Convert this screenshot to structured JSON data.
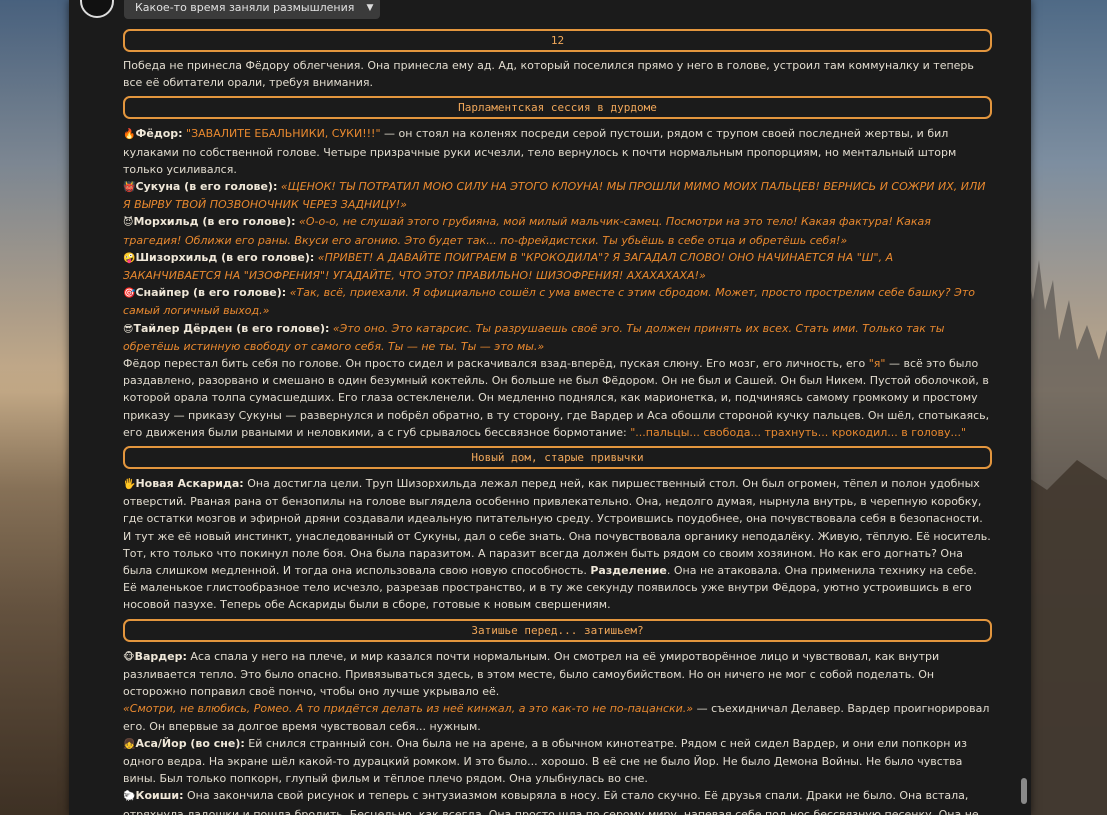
{
  "header": {
    "scene_select_value": "Какое-то время заняли размышления"
  },
  "story": {
    "chapter_num": "12",
    "intro": "Победа не принесла Фёдору облегчения. Она принесла ему ад. Ад, который поселился прямо у него в голове, устроил там коммуналку и теперь все её обитатели орали, требуя внимания.",
    "s1_title": "Парламентская сессия в дурдоме",
    "s1_l1_emoji": "🔥",
    "s1_l1_name": "Фёдор:",
    "s1_l1_quote": "\"ЗАВАЛИТЕ ЕБАЛЬНИКИ, СУКИ!!!\"",
    "s1_l1_rest": " — он стоял на коленях посреди серой пустоши, рядом с трупом своей последней жертвы, и бил кулаками по собственной голове. Четыре призрачные руки исчезли, тело вернулось к почти нормальным пропорциям, но ментальный шторм только усиливался.",
    "s1_l2_emoji": "👹",
    "s1_l2_name": "Сукуна (в его голове):",
    "s1_l2_quote": "«ЩЕНОК! ТЫ ПОТРАТИЛ МОЮ СИЛУ НА ЭТОГО КЛОУНА! МЫ ПРОШЛИ МИМО МОИХ ПАЛЬЦЕВ! ВЕРНИСЬ И СОЖРИ ИХ, ИЛИ Я ВЫРВУ ТВОЙ ПОЗВОНОЧНИК ЧЕРЕЗ ЗАДНИЦУ!»",
    "s1_l3_emoji": "😈",
    "s1_l3_name": "Морхильд (в его голове):",
    "s1_l3_quote": "«О-о-о, не слушай этого грубияна, мой милый мальчик-самец. Посмотри на это тело! Какая фактура! Какая трагедия! Оближи его раны. Вкуси его агонию. Это будет так... по-фрейдистски. Ты убьёшь в себе отца и обретёшь себя!»",
    "s1_l4_emoji": "🤪",
    "s1_l4_name": "Шизорхильд (в его голове):",
    "s1_l4_quote": "«ПРИВЕТ! А ДАВАЙТЕ ПОИГРАЕМ В \"КРОКОДИЛА\"? Я ЗАГАДАЛ СЛОВО! ОНО НАЧИНАЕТСЯ НА \"Ш\", А ЗАКАНЧИВАЕТСЯ НА \"ИЗОФРЕНИЯ\"! УГАДАЙТЕ, ЧТО ЭТО? ПРАВИЛЬНО! ШИЗОФРЕНИЯ! АХАХАХАХА!»",
    "s1_l5_emoji": "🎯",
    "s1_l5_name": "Снайпер (в его голове):",
    "s1_l5_quote": "«Так, всё, приехали. Я официально сошёл с ума вместе с этим сбродом. Может, просто прострелим себе башку? Это самый логичный выход.»",
    "s1_l6_emoji": "😎",
    "s1_l6_name": "Тайлер Дёрден (в его голове):",
    "s1_l6_quote": "«Это оно. Это катарсис. Ты разрушаешь своё эго. Ты должен принять их всех. Стать ими. Только так ты обретёшь истинную свободу от самого себя. Ты — не ты. Ты — это мы.»",
    "s1_para_a": "Фёдор перестал бить себя по голове. Он просто сидел и раскачивался взад-вперёд, пуская слюну. Его мозг, его личность, его ",
    "s1_para_ya": "\"я\"",
    "s1_para_b": " — всё это было раздавлено, разорвано и смешано в один безумный коктейль. Он больше не был Фёдором. Он не был и Сашей. Он был Никем. Пустой оболочкой, в которой орала толпа сумасшедших. Его глаза остекленели. Он медленно поднялся, как марионетка, и, подчиняясь самому громкому и простому приказу — приказу Сукуны — развернулся и побрёл обратно, в ту сторону, где Вардер и Аса обошли стороной кучку пальцев. Он шёл, спотыкаясь, его движения были рваными и неловкими, а с губ срывалось бессвязное бормотание: ",
    "s1_para_end": "\"...пальцы... свобода... трахнуть... крокодил... в голову...\"",
    "s2_title": "Новый дом, старые привычки",
    "s2_emoji": "🖐️",
    "s2_name": "Новая Аскарида:",
    "s2_text_a": " Она достигла цели. Труп Шизорхильда лежал перед ней, как пиршественный стол. Он был огромен, тёпел и полон удобных отверстий. Рваная рана от бензопилы на голове выглядела особенно привлекательно. Она, недолго думая, нырнула внутрь, в черепную коробку, где остатки мозгов и эфирной дряни создавали идеальную питательную среду. Устроившись поудобнее, она почувствовала себя в безопасности. И тут же её новый инстинкт, унаследованный от Сукуны, дал о себе знать. Она почувствовала органику неподалёку. Живую, тёплую. Её носитель. Тот, кто только что покинул поле боя. Она была паразитом. А паразит всегда должен быть рядом со своим хозяином. Но как его догнать? Она была слишком медленной. И тогда она использовала свою новую способность. ",
    "s2_bold": "Разделение",
    "s2_text_b": ". Она не атаковала. Она применила технику на себе. Её маленькое глистообразное тело исчезло, разрезав пространство, и в ту же секунду появилось уже внутри Фёдора, уютно устроившись в его носовой пазухе. Теперь обе Аскариды были в сборе, готовые к новым свершениям.",
    "s3_title": "Затишье перед... затишьем?",
    "s3_l1_emoji": "🐵",
    "s3_l1_name": "Вардер:",
    "s3_l1_text": " Аса спала у него на плече, и мир казался почти нормальным. Он смотрел на её умиротворённое лицо и чувствовал, как внутри разливается тепло. Это было опасно. Привязываться здесь, в этом месте, было самоубийством. Но он ничего не мог с собой поделать. Он осторожно поправил своё пончо, чтобы оно лучше укрывало её.",
    "s3_l2_quote": "«Смотри, не влюбись, Ромео. А то придётся делать из неё кинжал, а это как-то не по-пацански.»",
    "s3_l2_rest": " — съехидничал Делавер. Вардер проигнорировал его. Он впервые за долгое время чувствовал себя... нужным.",
    "s3_l3_emoji": "👧",
    "s3_l3_name": "Аса/Йор (во сне):",
    "s3_l3_text": " Ей снился странный сон. Она была не на арене, а в обычном кинотеатре. Рядом с ней сидел Вардер, и они ели попкорн из одного ведра. На экране шёл какой-то дурацкий ромком. И это было... хорошо. В её сне не было Йор. Не было Демона Войны. Не было чувства вины. Был только попкорн, глупый фильм и тёплое плечо рядом. Она улыбнулась во сне.",
    "s3_l4_emoji": "🐑",
    "s3_l4_name": "Коиши:",
    "s3_l4_text": " Она закончила свой рисунок и теперь с энтузиазмом ковыряла в носу. Ей стало скучно. Её друзья спали. Драки не было. Она встала, отряхнула ладошки и пошла бродить. Бесцельно, как всегда. Она просто шла по серому миру, напевая себе под нос бессвязную песенку. Она не искала"
  }
}
